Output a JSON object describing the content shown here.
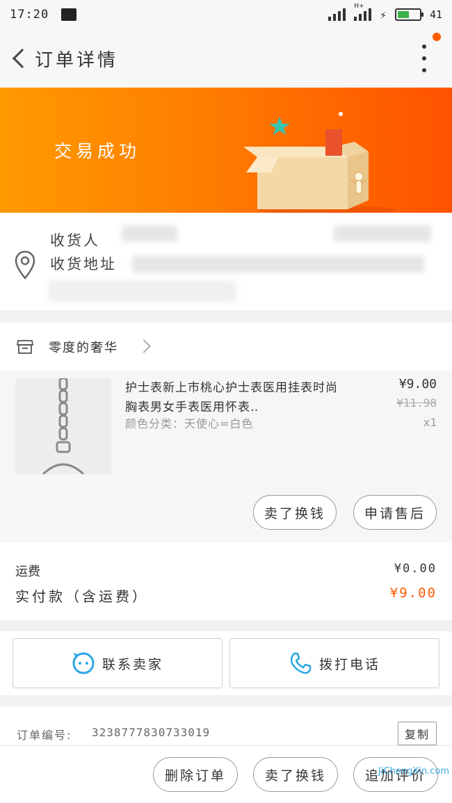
{
  "status_bar": {
    "time": "17:20",
    "network": "H+",
    "battery": "41"
  },
  "nav": {
    "title": "订单详情"
  },
  "banner": {
    "status_text": "交易成功"
  },
  "address": {
    "recipient_label": "收货人",
    "address_label": "收货地址"
  },
  "store": {
    "name": "零度的奢华"
  },
  "product": {
    "title": "护士表新上市桃心护士表医用挂表时尚胸表男女手表医用怀表‥",
    "sku": "颜色分类：天使心=白色",
    "price": "¥9.00",
    "original_price": "¥11.98",
    "quantity": "x1"
  },
  "product_actions": {
    "exchange": "卖了换钱",
    "after_sale": "申请售后"
  },
  "payment": {
    "shipping_label": "运费",
    "shipping_value": "¥0.00",
    "total_label": "实付款（含运费）",
    "total_value": "¥9.00"
  },
  "contact": {
    "seller": "联系卖家",
    "phone": "拨打电话"
  },
  "order": {
    "number_label": "订单编号:",
    "number_value": "3238777830733019",
    "copy": "复制"
  },
  "bottom_bar": {
    "delete": "删除订单",
    "exchange": "卖了换钱",
    "review": "追加评价"
  },
  "watermark": "JiChengXin.com",
  "colors": {
    "accent": "#ff5a00",
    "banner_start": "#ff9a00",
    "banner_end": "#ff5200",
    "chat_icon": "#29a7e1"
  }
}
